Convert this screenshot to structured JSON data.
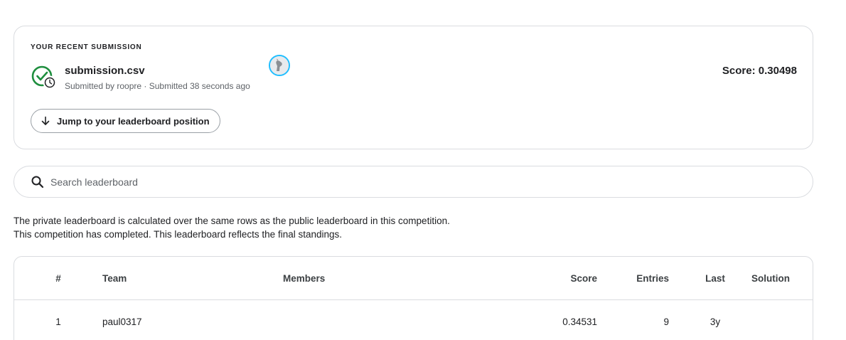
{
  "submission": {
    "heading": "YOUR RECENT SUBMISSION",
    "file_name": "submission.csv",
    "submitted_line": "Submitted by roopre · Submitted 38 seconds ago",
    "score_text": "Score: 0.30498",
    "jump_label": "Jump to your leaderboard position",
    "status_icon": "check-clock-icon",
    "status_color": "#1e8e3e"
  },
  "search": {
    "placeholder": "Search leaderboard",
    "value": ""
  },
  "info": {
    "line1": "The private leaderboard is calculated over the same rows as the public leaderboard in this competition.",
    "line2": "This competition has completed. This leaderboard reflects the final standings."
  },
  "leaderboard": {
    "columns": [
      "#",
      "Team",
      "Members",
      "Score",
      "Entries",
      "Last",
      "Solution"
    ],
    "rows": [
      {
        "rank": "1",
        "team": "paul0317",
        "score": "0.34531",
        "entries": "9",
        "last": "3y",
        "solution": ""
      }
    ]
  },
  "colors": {
    "border": "#dadce0",
    "avatar_ring": "#20beff"
  }
}
